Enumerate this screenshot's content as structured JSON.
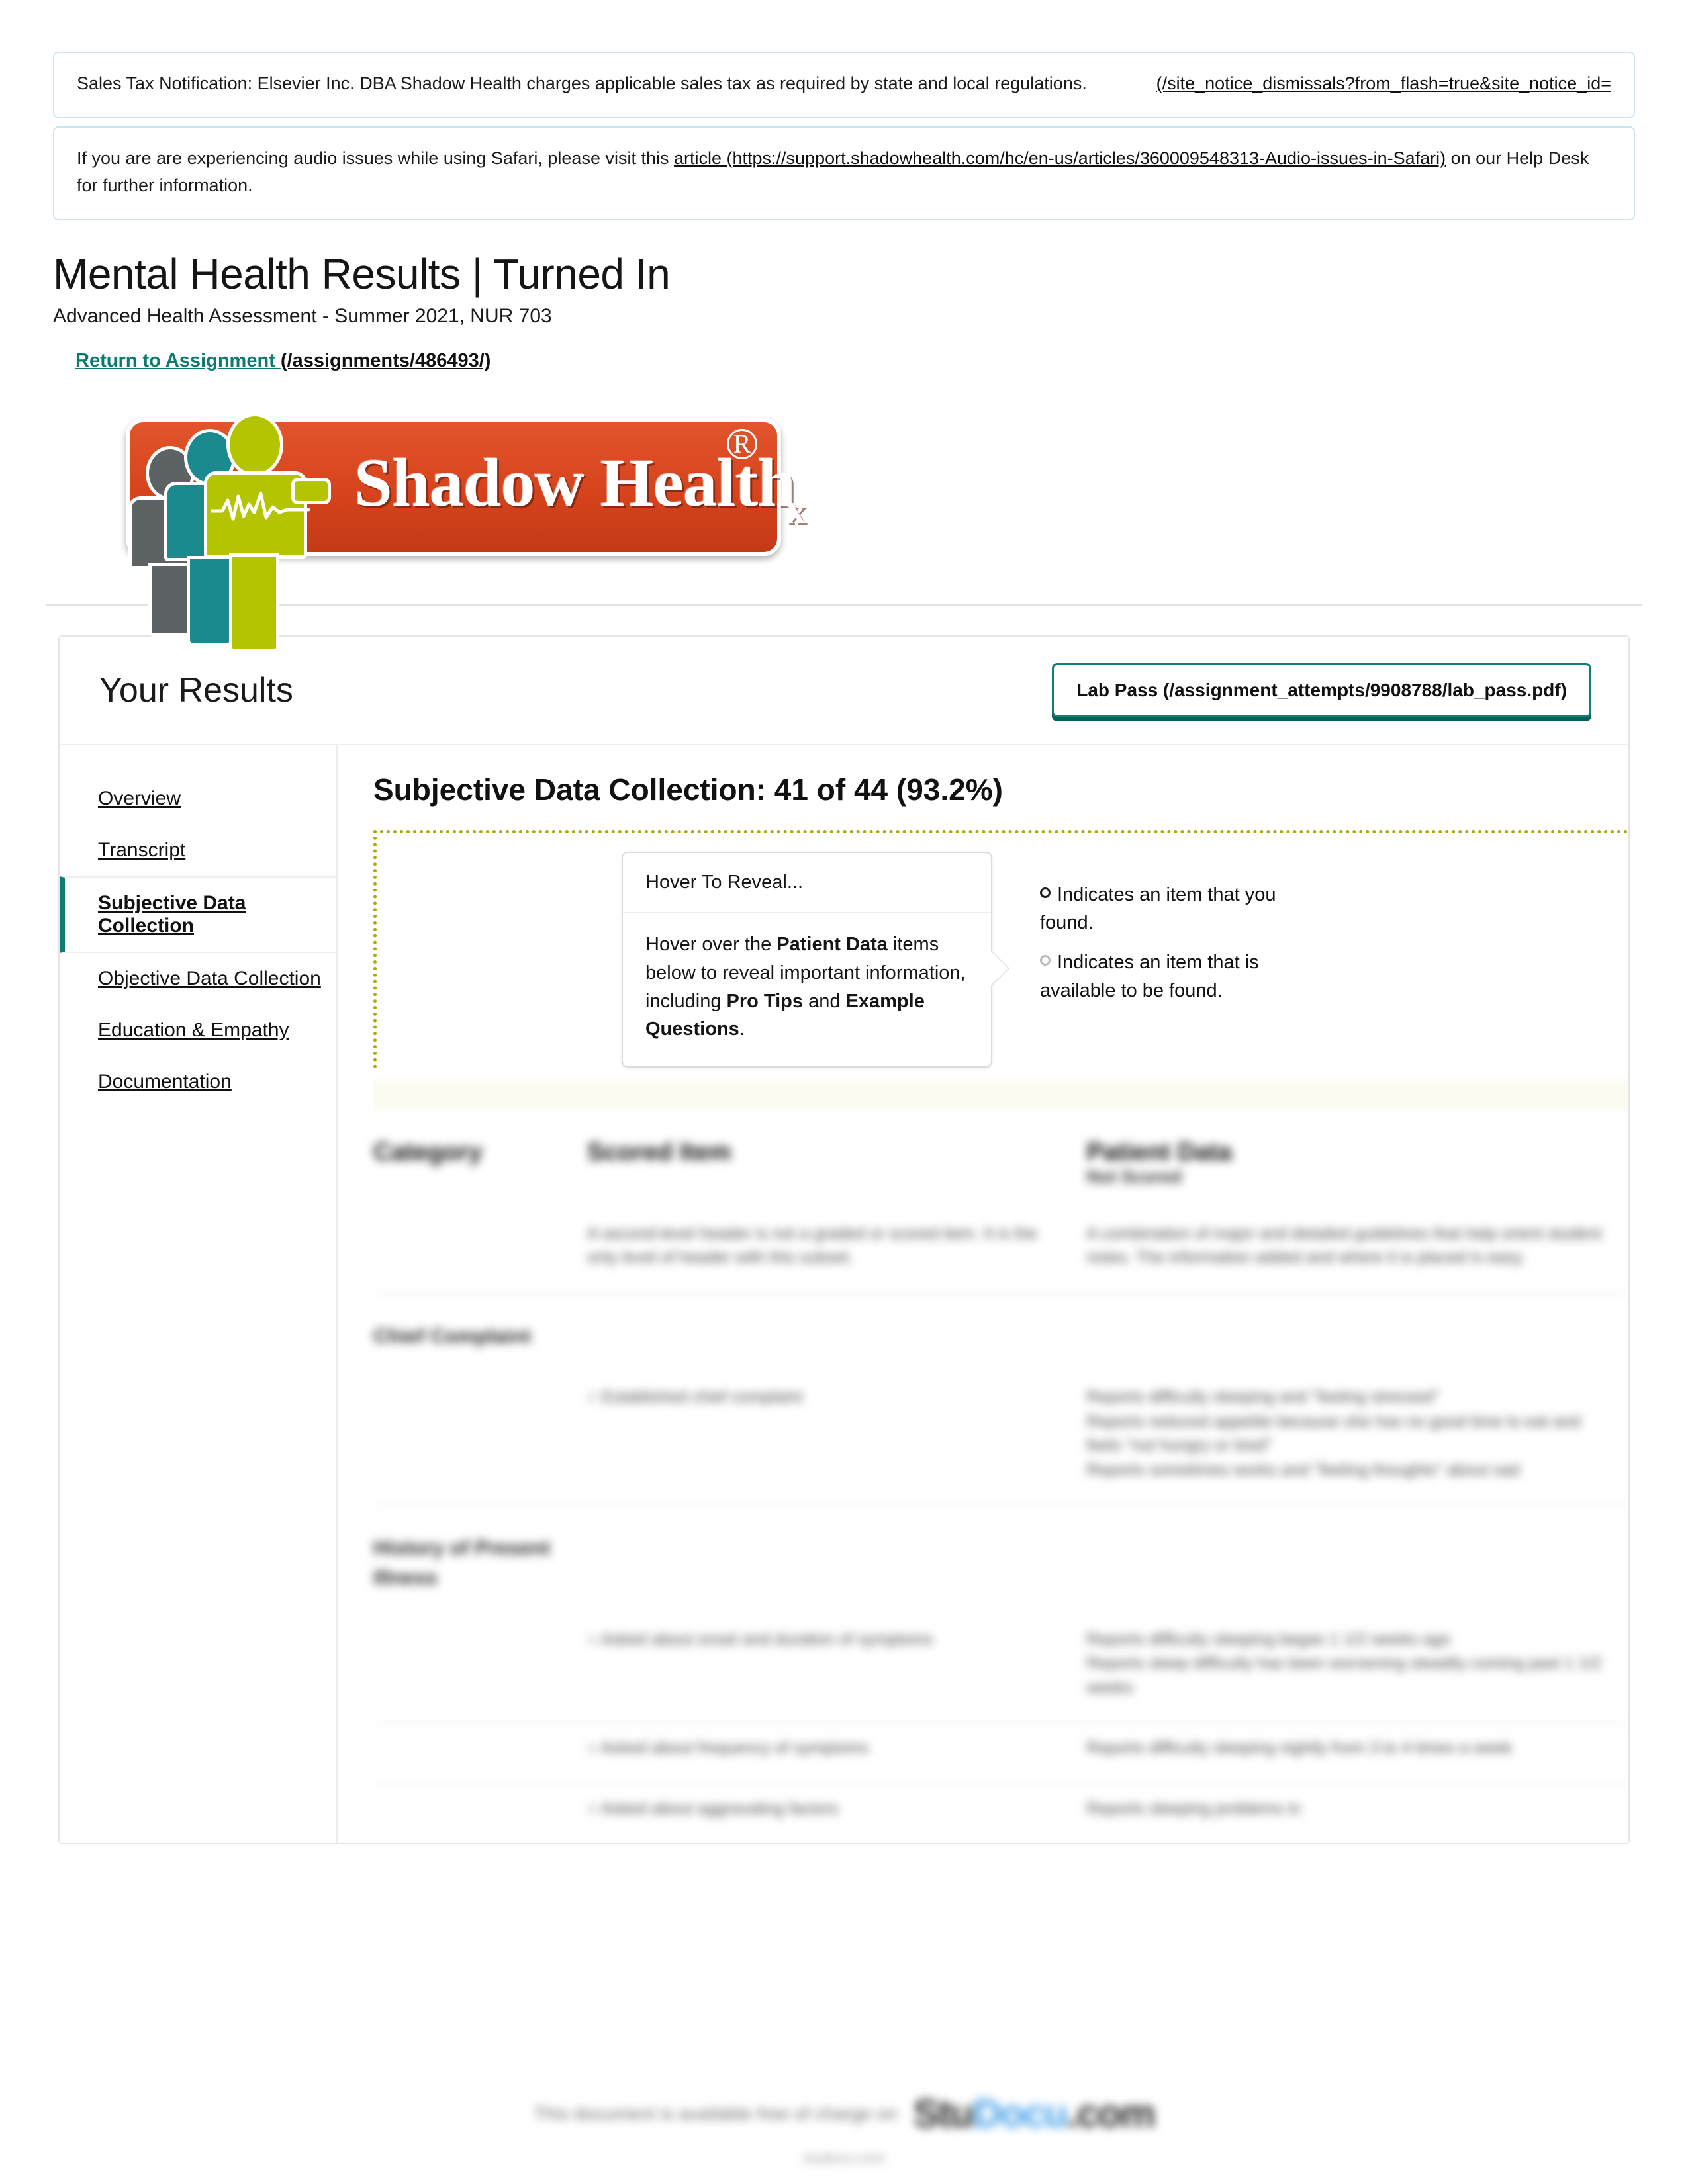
{
  "notices": [
    {
      "text": "Sales Tax Notification: Elsevier Inc. DBA Shadow Health charges applicable sales tax as required by state and local regulations.",
      "dismiss_link": "(/site_notice_dismissals?from_flash=true&site_notice_id="
    },
    {
      "text_before": "If you are are experiencing audio issues while using Safari, please visit this ",
      "link": "article (https://support.shadowhealth.com/hc/en-us/articles/360009548313-Audio-issues-in-Safari)",
      "text_after": " on our Help Desk for further information."
    }
  ],
  "header": {
    "title": "Mental Health Results | Turned In",
    "subtitle": "Advanced Health Assessment - Summer 2021, NUR 703",
    "return_label": "Return to Assignment ",
    "return_path": "(/assignments/486493/)"
  },
  "logo": {
    "wordmark": "Shadow Health",
    "sub_x": "x",
    "registered": "®",
    "plate_color": "#d6431d",
    "figure_green": "#b5c400",
    "figure_teal": "#1b8a8f",
    "figure_gray": "#5d6365"
  },
  "results": {
    "title": "Your Results",
    "lab_pass_label": "Lab Pass (/assignment_attempts/9908788/lab_pass.pdf)",
    "accent_color": "#0e7c74"
  },
  "sidebar": {
    "items": [
      {
        "label": "Overview",
        "active": false
      },
      {
        "label": "Transcript",
        "active": false
      },
      {
        "label": "Subjective Data Collection",
        "active": true
      },
      {
        "label": "Objective Data Collection",
        "active": false
      },
      {
        "label": "Education & Empathy",
        "active": false
      },
      {
        "label": "Documentation",
        "active": false
      }
    ]
  },
  "section": {
    "heading": "Subjective Data Collection: 41 of 44 (93.2%)",
    "found": 41,
    "total": 44,
    "percent": "93.2%"
  },
  "callout": {
    "head": "Hover To Reveal...",
    "body_1": "Hover over the ",
    "body_b1": "Patient Data",
    "body_2": " items below to reveal important information, including ",
    "body_b2": "Pro Tips",
    "body_3": " and ",
    "body_b3": "Example Questions",
    "body_4": "."
  },
  "legend": {
    "found_text": "Indicates an item that you found.",
    "available_text": "Indicates an item that is available to be found."
  },
  "table": {
    "headers": [
      "Category",
      "Scored Item",
      "Patient Data"
    ],
    "patient_data_sub": "Not Scored",
    "intro_row": {
      "scored_item": "A second-level header is not a graded or scored item. It is the only level of header with this subset.",
      "patient_data": "A combination of major and detailed guidelines that help orient student notes. The information added and where it is placed is easy."
    },
    "groups": [
      {
        "category": "Chief Complaint",
        "rows": [
          {
            "scored_item": "Established chief complaint",
            "patient_data": "Reports difficulty sleeping and \"feeling stressed\"\nReports reduced appetite because she has no good time to eat and feels \"not hungry or tired\"\nReports sometimes works and \"feeling thoughts\" about sad"
          }
        ]
      },
      {
        "category": "History of Present Illness",
        "rows": [
          {
            "scored_item": "Asked about onset and duration of symptoms",
            "patient_data": "Reports difficulty sleeping began 1 1/2 weeks ago\nReports sleep difficulty has been worsening steadily coming past 1 1/2 weeks"
          },
          {
            "scored_item": "Asked about frequency of symptoms",
            "patient_data": "Reports difficulty sleeping nightly from 3 to 4 times a week"
          },
          {
            "scored_item": "Asked about aggravating factors",
            "patient_data": "Reports sleeping problems in"
          }
        ]
      }
    ]
  },
  "footer": {
    "watermark_text": "This document is available free of charge on",
    "brand_a": "Stu",
    "brand_b": "Docu",
    "brand_c": ".com",
    "brand_sub": "studocu.com"
  }
}
